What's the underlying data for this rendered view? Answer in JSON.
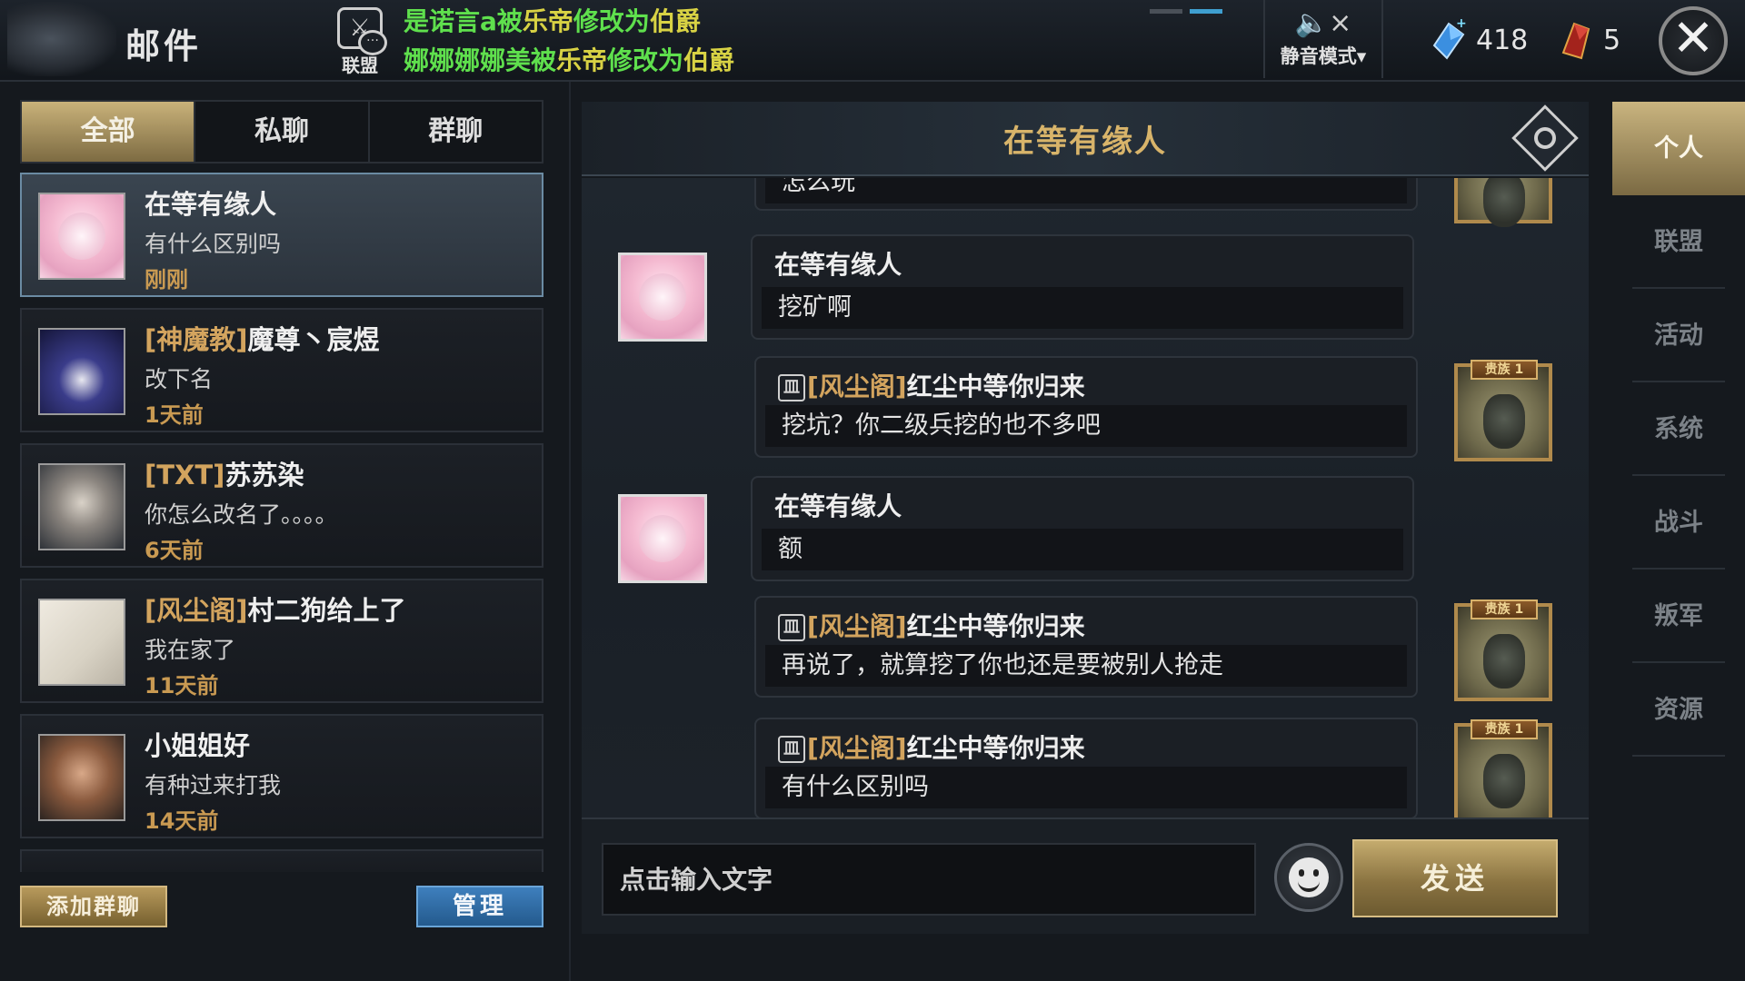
{
  "header": {
    "title": "邮件",
    "alliance_label": "联盟",
    "notices": [
      {
        "pre": "是诺言a被",
        "actor": "乐帝",
        "mid": "修改为",
        "rank": "伯爵"
      },
      {
        "pre": "娜娜娜娜美被",
        "actor": "乐帝",
        "mid": "修改为",
        "rank": "伯爵"
      }
    ],
    "mute_label": "静音模式▾",
    "mute_icon": "🔈×",
    "diamonds": "418",
    "tokens": "5",
    "close": "✕"
  },
  "tabs": [
    {
      "label": "全部",
      "active": true
    },
    {
      "label": "私聊",
      "active": false
    },
    {
      "label": "群聊",
      "active": false
    }
  ],
  "conversations": [
    {
      "tag": "",
      "name": "在等有缘人",
      "message": "有什么区别吗",
      "time": "刚刚"
    },
    {
      "tag": "[神魔教]",
      "name": "魔尊丶宸煜",
      "message": "改下名",
      "time": "1天前"
    },
    {
      "tag": "[TXT]",
      "name": "苏苏染",
      "message": "你怎么改名了。。。。",
      "time": "6天前"
    },
    {
      "tag": "[风尘阁]",
      "name": "村二狗给上了",
      "message": "我在家了",
      "time": "11天前"
    },
    {
      "tag": "",
      "name": "小姐姐好",
      "message": "有种过来打我",
      "time": "14天前"
    }
  ],
  "buttons": {
    "add_group": "添加群聊",
    "manage": "管理",
    "send": "发送"
  },
  "chat": {
    "title": "在等有缘人",
    "input_placeholder": "点击输入文字",
    "partial_top": "怎么玩",
    "messages": [
      {
        "side": "left",
        "tag": "",
        "name": "在等有缘人",
        "text": "挖矿啊"
      },
      {
        "side": "right",
        "tag": "[风尘阁]",
        "name": "红尘中等你归来",
        "text": "挖坑？你二级兵挖的也不多吧",
        "noble": "贵族 1"
      },
      {
        "side": "left",
        "tag": "",
        "name": "在等有缘人",
        "text": "额"
      },
      {
        "side": "right",
        "tag": "[风尘阁]",
        "name": "红尘中等你归来",
        "text": "再说了，就算挖了你也还是要被别人抢走",
        "noble": "贵族 1"
      },
      {
        "side": "right",
        "tag": "[风尘阁]",
        "name": "红尘中等你归来",
        "text": "有什么区别吗",
        "noble": "贵族 1"
      }
    ]
  },
  "side_tabs": [
    "个人",
    "联盟",
    "活动",
    "系统",
    "战斗",
    "叛军",
    "资源"
  ]
}
